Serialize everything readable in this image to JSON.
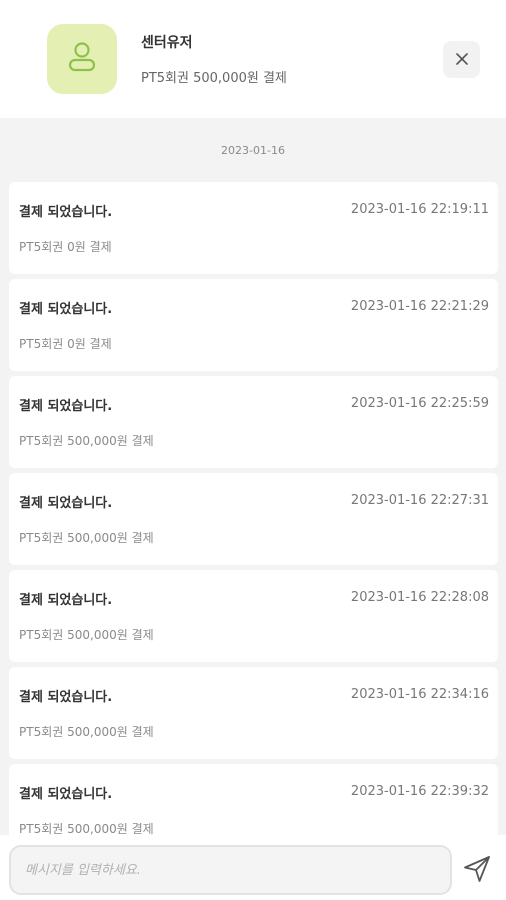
{
  "header": {
    "name": "센터유저",
    "description": "PT5회권 500,000원 결제",
    "avatar_color": "#e4efb3",
    "avatar_icon": "user-icon",
    "close_icon": "close-icon"
  },
  "chat": {
    "date_separator": "2023-01-16",
    "messages": [
      {
        "title": "결제 되었습니다.",
        "time": "2023-01-16 22:19:11",
        "desc": "PT5회권 0원 결제"
      },
      {
        "title": "결제 되었습니다.",
        "time": "2023-01-16 22:21:29",
        "desc": "PT5회권 0원 결제"
      },
      {
        "title": "결제 되었습니다.",
        "time": "2023-01-16 22:25:59",
        "desc": "PT5회권 500,000원 결제"
      },
      {
        "title": "결제 되었습니다.",
        "time": "2023-01-16 22:27:31",
        "desc": "PT5회권 500,000원 결제"
      },
      {
        "title": "결제 되었습니다.",
        "time": "2023-01-16 22:28:08",
        "desc": "PT5회권 500,000원 결제"
      },
      {
        "title": "결제 되었습니다.",
        "time": "2023-01-16 22:34:16",
        "desc": "PT5회권 500,000원 결제"
      },
      {
        "title": "결제 되었습니다.",
        "time": "2023-01-16 22:39:32",
        "desc": "PT5회권 500,000원 결제"
      }
    ]
  },
  "composer": {
    "placeholder": "메시지를 입력하세요.",
    "value": "",
    "send_icon": "send-icon"
  }
}
